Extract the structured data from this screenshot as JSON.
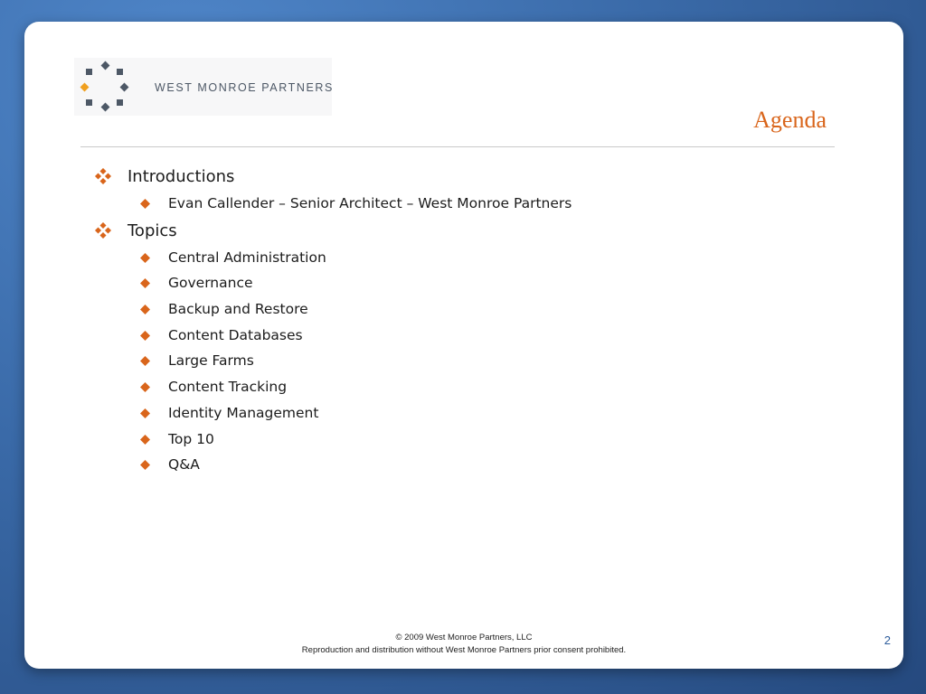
{
  "brand": {
    "name": "WEST MONROE PARTNERS",
    "logo_icon": "diamond-ring-logo",
    "colors": {
      "accent": "#d9651b",
      "logo_gray": "#4d5866",
      "logo_orange": "#f0a020",
      "background_blue": "#3a6aa8"
    }
  },
  "slide": {
    "title": "Agenda",
    "page_number": "2"
  },
  "agenda": [
    {
      "label": "Introductions",
      "bullet_icon": "four-diamond-bullet-icon",
      "items": [
        {
          "label": "Evan Callender – Senior Architect – West Monroe Partners"
        }
      ]
    },
    {
      "label": "Topics",
      "bullet_icon": "four-diamond-bullet-icon",
      "items": [
        {
          "label": "Central Administration"
        },
        {
          "label": "Governance"
        },
        {
          "label": "Backup and Restore"
        },
        {
          "label": "Content Databases"
        },
        {
          "label": "Large Farms"
        },
        {
          "label": "Content Tracking"
        },
        {
          "label": "Identity Management"
        },
        {
          "label": "Top 10"
        },
        {
          "label": "Q&A"
        }
      ]
    }
  ],
  "footer": {
    "copyright": "© 2009 West Monroe Partners, LLC",
    "notice": "Reproduction and distribution without West Monroe Partners prior consent prohibited."
  }
}
